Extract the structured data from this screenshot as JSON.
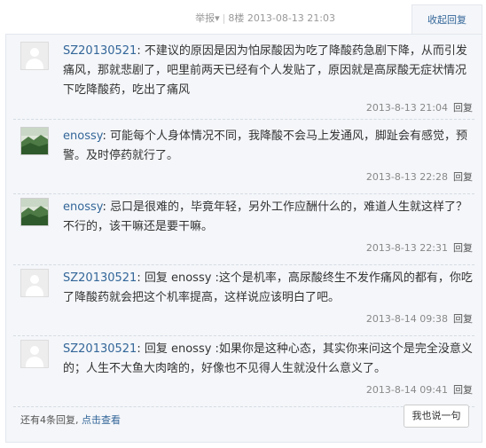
{
  "header": {
    "report_label": "举报",
    "report_arrow": "▾",
    "separator": "|",
    "floor": "8楼",
    "datetime": "2013-08-13 21:03",
    "collapse_label": "收起回复"
  },
  "replies": [
    {
      "avatar": "default-avatar",
      "username": "SZ20130521",
      "colon": ": ",
      "content": "不建议的原因是因为怕尿酸因为吃了降酸药急剧下降，从而引发痛风，那就悲剧了，吧里前两天已经有个人发贴了，原因就是高尿酸无症状情况下吃降酸药，吃出了痛风",
      "time": "2013-8-13 21:04",
      "reply_label": "回复"
    },
    {
      "avatar": "landscape-avatar",
      "username": "enossy",
      "colon": ": ",
      "content": "可能每个人身体情况不同，我降酸不会马上发通风，脚趾会有感觉，预警。及时停药就行了。",
      "time": "2013-8-13 22:28",
      "reply_label": "回复"
    },
    {
      "avatar": "landscape-avatar",
      "username": "enossy",
      "colon": ": ",
      "content": "忌口是很难的，毕竟年轻，另外工作应酬什么的，难道人生就这样了？不行的，该干嘛还是要干嘛。",
      "time": "2013-8-13 22:31",
      "reply_label": "回复"
    },
    {
      "avatar": "default-avatar",
      "username": "SZ20130521",
      "colon": ": ",
      "content": "回复 enossy :这个是机率，高尿酸终生不发作痛风的都有，你吃了降酸药就会把这个机率提高，这样说应该明白了吧。",
      "time": "2013-8-14 09:38",
      "reply_label": "回复"
    },
    {
      "avatar": "default-avatar",
      "username": "SZ20130521",
      "colon": ": ",
      "content": "回复 enossy :如果你是这种心态，其实你来问这个是完全没意义的；人生不大鱼大肉啥的，好像也不见得人生就没什么意义了。",
      "time": "2013-8-14 09:41",
      "reply_label": "回复"
    }
  ],
  "footer": {
    "more_prefix": "还有4条回复, ",
    "view_label": "点击查看",
    "say_button": "我也说一句"
  }
}
